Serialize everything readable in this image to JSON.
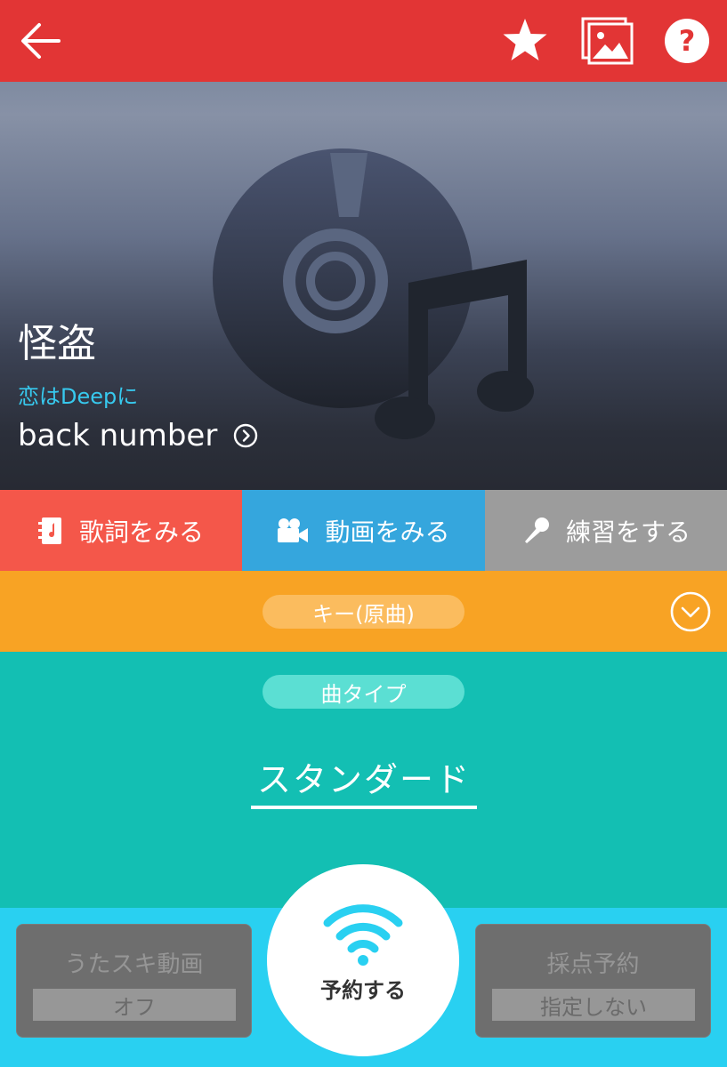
{
  "header": {
    "back_icon": "back-arrow-icon",
    "favorite_icon": "star-icon",
    "image_icon": "image-icon",
    "help_icon": "help-icon"
  },
  "song": {
    "title": "怪盗",
    "subtitle": "恋はDeepに",
    "artist": "back number",
    "artwork_icon": "cd-music-note-icon"
  },
  "actions": [
    {
      "label": "歌詞をみる",
      "icon": "lyrics-book-icon",
      "color": "#f4574a"
    },
    {
      "label": "動画をみる",
      "icon": "video-camera-icon",
      "color": "#35a6dd"
    },
    {
      "label": "練習をする",
      "icon": "microphone-icon",
      "color": "#9c9c9c"
    }
  ],
  "key": {
    "label": "キー(原曲)",
    "color": "#f8a324"
  },
  "song_type": {
    "label": "曲タイプ",
    "value": "スタンダード",
    "color": "#13bfb3"
  },
  "bottom": {
    "uta_suki": {
      "title": "うたスキ動画",
      "value": "オフ"
    },
    "reserve": {
      "label": "予約する",
      "icon": "wifi-signal-icon"
    },
    "scoring": {
      "title": "採点予約",
      "value": "指定しない"
    },
    "color": "#29d0f1"
  }
}
